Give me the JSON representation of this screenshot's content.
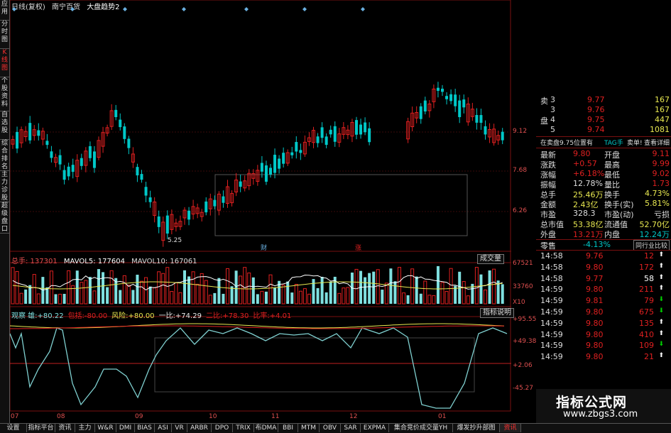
{
  "sidebar": [
    "应用",
    "分时图",
    "K线图",
    "个股资料",
    "自选股",
    "综合排名",
    "主力诊股",
    "超级盘口"
  ],
  "sidebar_active": 2,
  "title": {
    "period": "日线(复权)",
    "stock": "南宁百货",
    "overlay": "大盘趋势2"
  },
  "price_axis": [
    "9.12",
    "7.68",
    "6.26"
  ],
  "low_label": "5.25",
  "chart_markers": [
    "财",
    "涨"
  ],
  "volume": {
    "label": "总手: 137301",
    "ma5": "MAVOL5: 177604",
    "ma10": "MAVOL10: 167061",
    "button": "成交量",
    "axis": [
      "67521",
      "33760",
      "X10"
    ]
  },
  "indicator": {
    "items": [
      "观察 雄:+80.22",
      "包括:-80.00",
      "风险:+80.00",
      "一比:+74.29",
      "二比:+78.30",
      "比率:+4.01"
    ],
    "button": "指标说明",
    "axis": [
      "+95.55",
      "+49.38",
      "+2.06",
      "-45.27"
    ]
  },
  "time_axis": [
    "07",
    "08",
    "09",
    "10",
    "11",
    "12",
    "01"
  ],
  "orderbook": [
    {
      "side": "卖",
      "level": "3",
      "price": "9.77",
      "vol": "167"
    },
    {
      "side": "",
      "level": "3",
      "price": "9.76",
      "vol": "167"
    },
    {
      "side": "盘",
      "level": "4",
      "price": "9.75",
      "vol": "447"
    },
    {
      "side": "",
      "level": "5",
      "price": "9.74",
      "vol": "1081"
    }
  ],
  "ticker_bar": {
    "a": "在卖盘9.75位置有",
    "b": "TAG手",
    "c": "卖单!",
    "d": "查看详细"
  },
  "quotes": [
    {
      "l1": "最新",
      "v1": "9.80",
      "l2": "开盘",
      "v2": "9.11"
    },
    {
      "l1": "涨跌",
      "v1": "+0.57",
      "l2": "最高",
      "v2": "9.99"
    },
    {
      "l1": "涨幅",
      "v1": "+6.18%",
      "l2": "最低",
      "v2": "9.02"
    },
    {
      "l1": "振幅",
      "v1": "12.78%",
      "l2": "量比",
      "v2": "1.73"
    },
    {
      "l1": "总手",
      "v1": "25.46万",
      "l2": "换手",
      "v2": "4.73%"
    },
    {
      "l1": "金额",
      "v1": "2.43亿",
      "l2": "换手(实)",
      "v2": "5.81%"
    },
    {
      "l1": "市盈",
      "v1": "328.3",
      "l2": "市盈(动)",
      "v2": "亏损"
    },
    {
      "l1": "总市值",
      "v1": "53.38亿",
      "l2": "流通值",
      "v2": "52.70亿"
    },
    {
      "l1": "外盘",
      "v1": "13.21万",
      "l2": "内盘",
      "v2": "12.24万"
    }
  ],
  "industry": {
    "name": "零售",
    "change": "-4.13%",
    "button": "同行业比较"
  },
  "trades": [
    {
      "t": "14:58",
      "p": "9.76",
      "v": "12",
      "d": "up"
    },
    {
      "t": "14:58",
      "p": "9.80",
      "v": "172",
      "d": "up"
    },
    {
      "t": "14:58",
      "p": "9.77",
      "v": "58",
      "d": "up"
    },
    {
      "t": "14:59",
      "p": "9.80",
      "v": "211",
      "d": "up"
    },
    {
      "t": "14:59",
      "p": "9.81",
      "v": "79",
      "d": "down"
    },
    {
      "t": "14:59",
      "p": "9.80",
      "v": "675",
      "d": "down"
    },
    {
      "t": "14:59",
      "p": "9.80",
      "v": "135",
      "d": "up"
    },
    {
      "t": "14:59",
      "p": "9.80",
      "v": "410",
      "d": "up"
    },
    {
      "t": "14:59",
      "p": "9.80",
      "v": "109",
      "d": "down"
    },
    {
      "t": "14:59",
      "p": "9.80",
      "v": "21",
      "d": "up"
    }
  ],
  "bottom_tabs": [
    "设置",
    "指标平台",
    "资讯",
    "主力",
    "W&R",
    "DMI",
    "BIAS",
    "ASI",
    "VR",
    "ARBR",
    "DPO",
    "TRIX",
    "布DMA",
    "BBI",
    "MTM",
    "OBV",
    "SAR",
    "EXPMA",
    "集合竞价成交量YH",
    "爆发抄升部图",
    "资讯"
  ],
  "bottom_active": 20,
  "watermark": {
    "main": "指标公式网",
    "url": "www.zbgs3.com"
  },
  "colors": {
    "up": "#e02020",
    "down": "#00c8c8",
    "axis": "#e05050",
    "border": "#7a1010"
  }
}
